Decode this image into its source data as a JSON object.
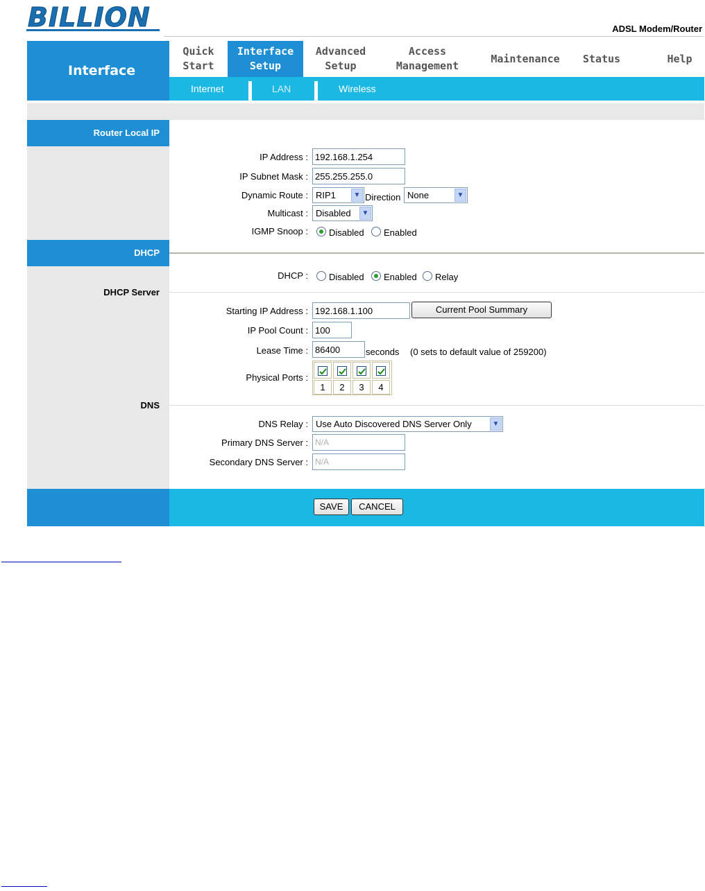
{
  "header": {
    "logo_text": "BILLION",
    "product": "ADSL Modem/Router"
  },
  "nav": {
    "section_title": "Interface",
    "items": [
      {
        "label": "Quick\nStart"
      },
      {
        "label": "Interface\nSetup"
      },
      {
        "label": "Advanced\nSetup"
      },
      {
        "label": "Access\nManagement"
      },
      {
        "label": "Maintenance"
      },
      {
        "label": "Status"
      },
      {
        "label": "Help"
      }
    ],
    "active_index": 1,
    "subtabs": [
      {
        "label": "Internet"
      },
      {
        "label": "LAN"
      },
      {
        "label": "Wireless"
      }
    ],
    "active_subtab": 1
  },
  "router_local_ip": {
    "heading": "Router Local IP",
    "ip_address_label": "IP Address :",
    "ip_address": "192.168.1.254",
    "subnet_label": "IP Subnet Mask :",
    "subnet": "255.255.255.0",
    "dynamic_route_label": "Dynamic Route :",
    "dynamic_route": "RIP1",
    "direction_label": "Direction",
    "direction": "None",
    "multicast_label": "Multicast :",
    "multicast": "Disabled",
    "igmp_label": "IGMP Snoop :",
    "igmp_options": [
      "Disabled",
      "Enabled"
    ],
    "igmp_selected": "Disabled"
  },
  "dhcp": {
    "heading": "DHCP",
    "dhcp_label": "DHCP :",
    "dhcp_options": [
      "Disabled",
      "Enabled",
      "Relay"
    ],
    "dhcp_selected": "Enabled",
    "server_heading": "DHCP Server",
    "start_ip_label": "Starting IP Address :",
    "start_ip": "192.168.1.100",
    "pool_button": "Current Pool Summary",
    "pool_count_label": "IP Pool Count :",
    "pool_count": "100",
    "lease_label": "Lease Time :",
    "lease_time": "86400",
    "lease_unit": "seconds",
    "lease_note": "(0 sets to default value of 259200)",
    "ports_label": "Physical Ports :",
    "ports": [
      {
        "num": "1",
        "checked": true
      },
      {
        "num": "2",
        "checked": true
      },
      {
        "num": "3",
        "checked": true
      },
      {
        "num": "4",
        "checked": true
      }
    ]
  },
  "dns": {
    "heading": "DNS",
    "relay_label": "DNS Relay :",
    "relay": "Use Auto Discovered DNS Server Only",
    "primary_label": "Primary DNS Server :",
    "primary": "N/A",
    "secondary_label": "Secondary DNS Server :",
    "secondary": "N/A"
  },
  "actions": {
    "save": "SAVE",
    "cancel": "CANCEL"
  },
  "colors": {
    "blue": "#1e8fd4",
    "cyan": "#1cb8e4",
    "gray": "#e8e8e8"
  }
}
